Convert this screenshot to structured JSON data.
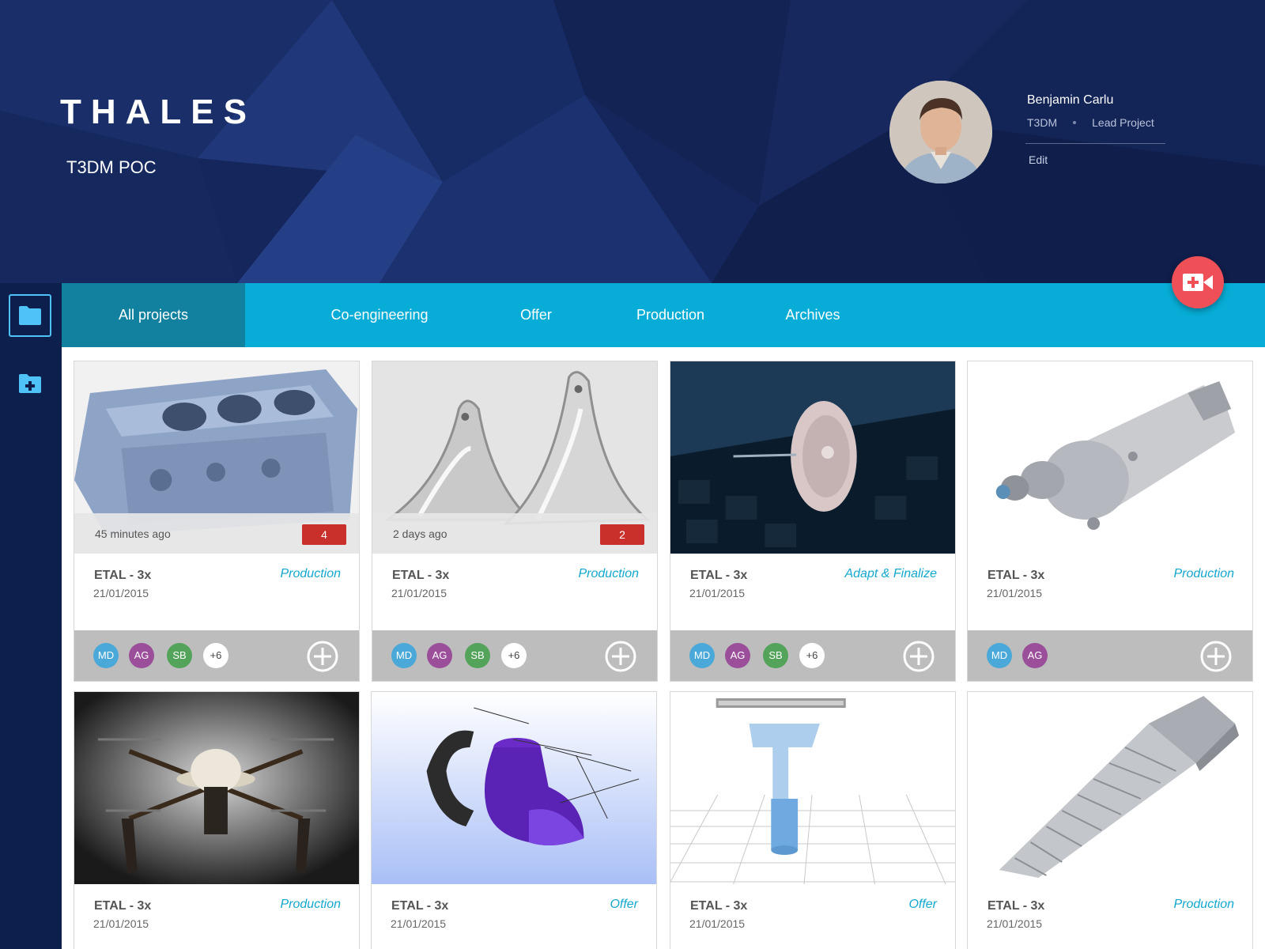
{
  "brand": {
    "logo_text": "THALES",
    "app_name": "T3DM POC"
  },
  "user": {
    "name": "Benjamin Carlu",
    "org": "T3DM",
    "role": "Lead Project",
    "edit_label": "Edit"
  },
  "tabs": [
    {
      "label": "All projects",
      "active": true
    },
    {
      "label": "Co-engineering",
      "active": false
    },
    {
      "label": "Offer",
      "active": false
    },
    {
      "label": "Production",
      "active": false
    },
    {
      "label": "Archives",
      "active": false
    }
  ],
  "sidebar": {
    "items": [
      {
        "icon": "folder-icon",
        "active": true
      },
      {
        "icon": "folder-add-icon",
        "active": false
      }
    ]
  },
  "fab": {
    "icon": "video-add-icon"
  },
  "colors": {
    "header_bg": "#14265c",
    "sidebar_bg": "#0c1f4d",
    "tabbar_bg": "#07add6",
    "tab_active_bg": "#12809f",
    "status_text": "#13a7cf",
    "badge_bg": "#c9302c",
    "fab_bg": "#ef4f57"
  },
  "projects": [
    {
      "title": "ETAL - 3x",
      "date": "21/01/2015",
      "status": "Production",
      "time_ago": "45 minutes ago",
      "notifications": "4",
      "members": [
        "MD",
        "AG",
        "SB"
      ],
      "more_members": "+6"
    },
    {
      "title": "ETAL - 3x",
      "date": "21/01/2015",
      "status": "Production",
      "time_ago": "2 days ago",
      "notifications": "2",
      "members": [
        "MD",
        "AG",
        "SB"
      ],
      "more_members": "+6"
    },
    {
      "title": "ETAL - 3x",
      "date": "21/01/2015",
      "status": "Adapt & Finalize",
      "members": [
        "MD",
        "AG",
        "SB"
      ],
      "more_members": "+6"
    },
    {
      "title": "ETAL - 3x",
      "date": "21/01/2015",
      "status": "Production",
      "members": [
        "MD",
        "AG"
      ]
    },
    {
      "title": "ETAL - 3x",
      "date": "21/01/2015",
      "status": "Production"
    },
    {
      "title": "ETAL - 3x",
      "date": "21/01/2015",
      "status": "Offer"
    },
    {
      "title": "ETAL - 3x",
      "date": "21/01/2015",
      "status": "Offer"
    },
    {
      "title": "ETAL - 3x",
      "date": "21/01/2015",
      "status": "Production"
    }
  ]
}
